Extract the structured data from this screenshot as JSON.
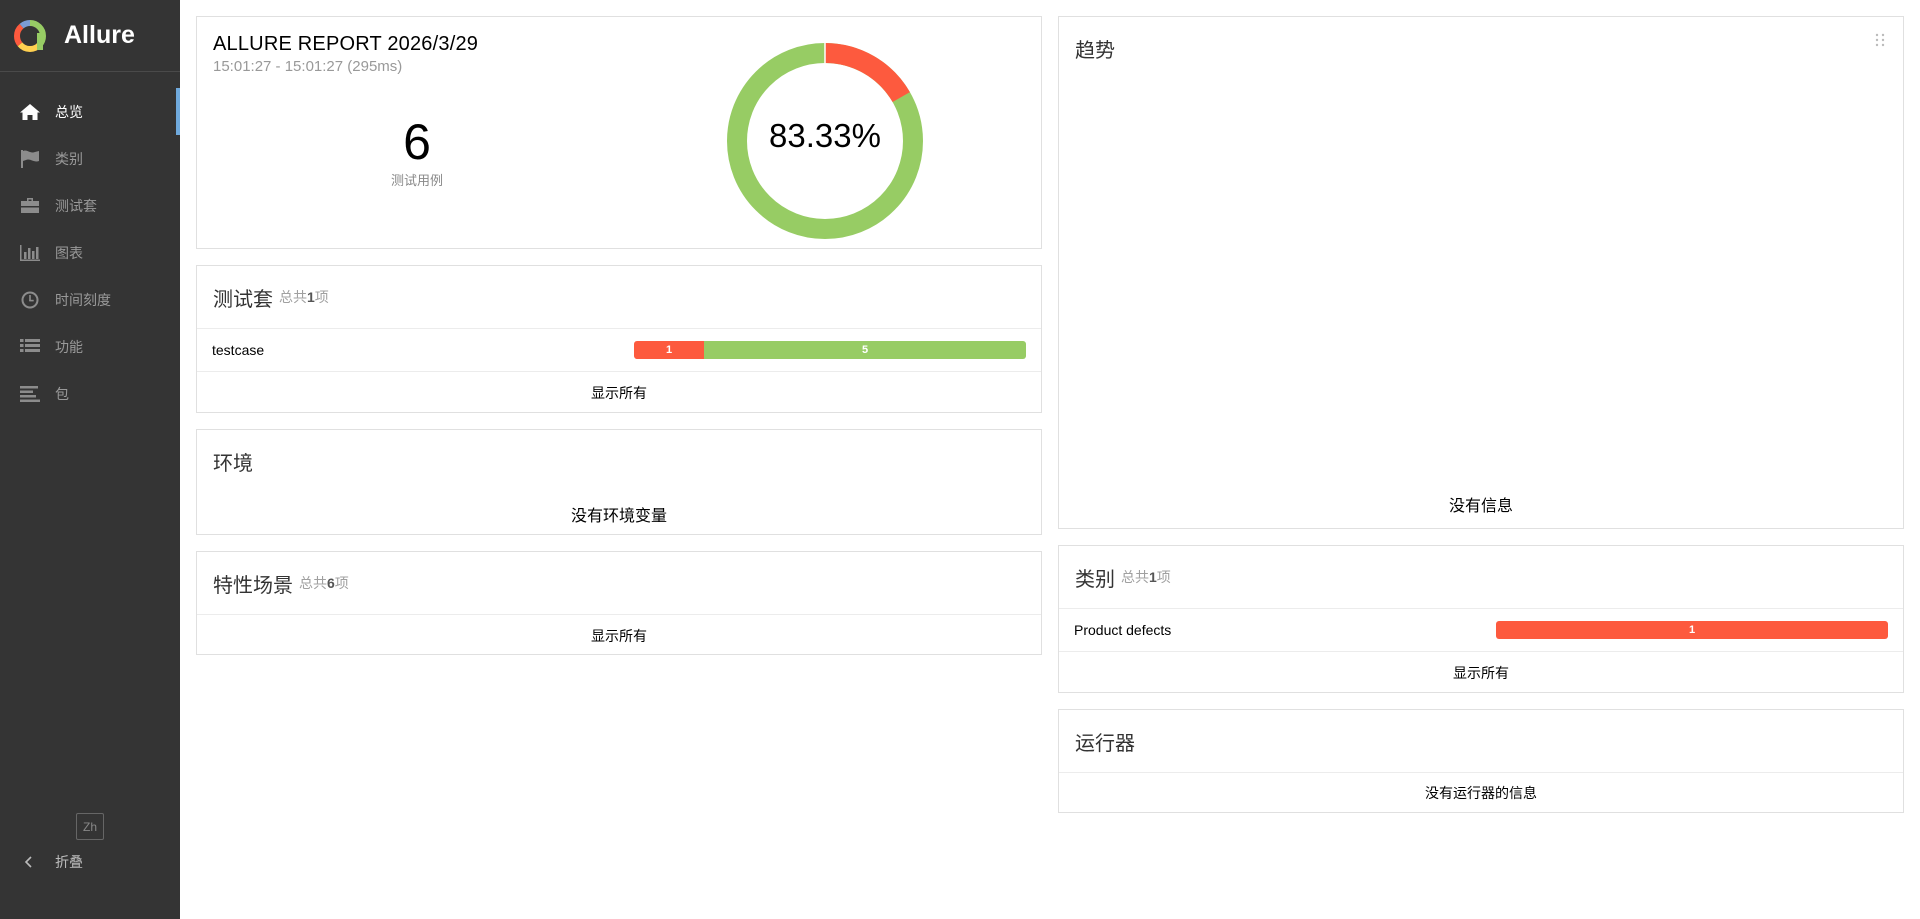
{
  "brand": {
    "name": "Allure"
  },
  "nav": {
    "items": [
      {
        "label": "总览",
        "icon": "home-icon"
      },
      {
        "label": "类别",
        "icon": "flag-icon"
      },
      {
        "label": "测试套",
        "icon": "briefcase-icon"
      },
      {
        "label": "图表",
        "icon": "bar-chart-icon"
      },
      {
        "label": "时间刻度",
        "icon": "clock-icon"
      },
      {
        "label": "功能",
        "icon": "list-icon"
      },
      {
        "label": "包",
        "icon": "align-left-icon"
      }
    ],
    "lang": "Zh",
    "collapse_label": "折叠"
  },
  "summary": {
    "title": "ALLURE REPORT 2026/3/29",
    "time": "15:01:27 - 15:01:27 (295ms)",
    "test_count": "6",
    "test_count_label": "测试用例",
    "pass_rate": "83.33%",
    "failed_fraction": 0.1667,
    "colors": {
      "failed": "#fd5a3e",
      "passed": "#97cc64"
    }
  },
  "suites": {
    "title": "测试套",
    "count_prefix": "总共",
    "count": "1",
    "count_suffix": "项",
    "rows": [
      {
        "name": "testcase",
        "failed": "1",
        "passed": "5"
      }
    ],
    "show_all": "显示所有"
  },
  "environment": {
    "title": "环境",
    "empty": "没有环境变量"
  },
  "features": {
    "title": "特性场景",
    "count_prefix": "总共",
    "count": "6",
    "count_suffix": "项",
    "show_all": "显示所有"
  },
  "trend": {
    "title": "趋势",
    "empty": "没有信息"
  },
  "categories": {
    "title": "类别",
    "count_prefix": "总共",
    "count": "1",
    "count_suffix": "项",
    "rows": [
      {
        "name": "Product defects",
        "failed": "1"
      }
    ],
    "show_all": "显示所有"
  },
  "executors": {
    "title": "运行器",
    "empty": "没有运行器的信息"
  }
}
